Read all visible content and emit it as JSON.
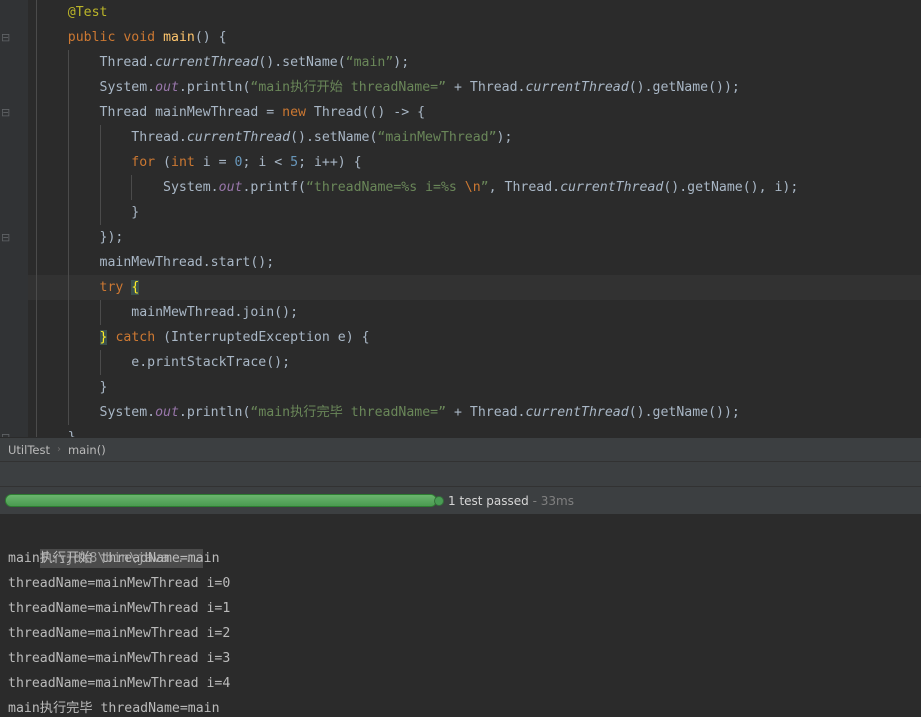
{
  "editor": {
    "lines": [
      {
        "indent": 0,
        "current": false,
        "fold": false,
        "tokens": [
          {
            "t": "anno",
            "v": "    @Test"
          }
        ]
      },
      {
        "indent": 0,
        "current": false,
        "fold": true,
        "tokens": [
          {
            "t": "plain",
            "v": "    "
          },
          {
            "t": "kw",
            "v": "public"
          },
          {
            "t": "plain",
            "v": " "
          },
          {
            "t": "kw",
            "v": "void"
          },
          {
            "t": "plain",
            "v": " "
          },
          {
            "t": "method",
            "v": "main"
          },
          {
            "t": "plain",
            "v": "() {"
          }
        ]
      },
      {
        "indent": 0,
        "current": false,
        "fold": false,
        "tokens": [
          {
            "t": "plain",
            "v": "        Thread."
          },
          {
            "t": "static",
            "v": "currentThread"
          },
          {
            "t": "plain",
            "v": "().setName("
          },
          {
            "t": "str",
            "v": "“main”"
          },
          {
            "t": "plain",
            "v": ");"
          }
        ]
      },
      {
        "indent": 0,
        "current": false,
        "fold": false,
        "tokens": [
          {
            "t": "plain",
            "v": "        System."
          },
          {
            "t": "field",
            "v": "out"
          },
          {
            "t": "plain",
            "v": ".println("
          },
          {
            "t": "str",
            "v": "“main执行开始 threadName=”"
          },
          {
            "t": "plain",
            "v": " + Thread."
          },
          {
            "t": "static",
            "v": "currentThread"
          },
          {
            "t": "plain",
            "v": "().getName());"
          }
        ]
      },
      {
        "indent": 0,
        "current": false,
        "fold": true,
        "tokens": [
          {
            "t": "plain",
            "v": "        Thread mainMewThread = "
          },
          {
            "t": "kw",
            "v": "new"
          },
          {
            "t": "plain",
            "v": " Thread(() -> {"
          }
        ]
      },
      {
        "indent": 0,
        "current": false,
        "fold": false,
        "tokens": [
          {
            "t": "plain",
            "v": "            Thread."
          },
          {
            "t": "static",
            "v": "currentThread"
          },
          {
            "t": "plain",
            "v": "().setName("
          },
          {
            "t": "str",
            "v": "“mainMewThread”"
          },
          {
            "t": "plain",
            "v": ");"
          }
        ]
      },
      {
        "indent": 0,
        "current": false,
        "fold": false,
        "tokens": [
          {
            "t": "plain",
            "v": "            "
          },
          {
            "t": "kw",
            "v": "for"
          },
          {
            "t": "plain",
            "v": " ("
          },
          {
            "t": "kw",
            "v": "int"
          },
          {
            "t": "plain",
            "v": " i = "
          },
          {
            "t": "num",
            "v": "0"
          },
          {
            "t": "plain",
            "v": "; i < "
          },
          {
            "t": "num",
            "v": "5"
          },
          {
            "t": "plain",
            "v": "; i++) {"
          }
        ]
      },
      {
        "indent": 0,
        "current": false,
        "fold": false,
        "tokens": [
          {
            "t": "plain",
            "v": "                System."
          },
          {
            "t": "field",
            "v": "out"
          },
          {
            "t": "plain",
            "v": ".printf("
          },
          {
            "t": "str",
            "v": "“threadName=%s i=%s "
          },
          {
            "t": "esc",
            "v": "\\n"
          },
          {
            "t": "str",
            "v": "”"
          },
          {
            "t": "plain",
            "v": ", Thread."
          },
          {
            "t": "static",
            "v": "currentThread"
          },
          {
            "t": "plain",
            "v": "().getName(), i);"
          }
        ]
      },
      {
        "indent": 0,
        "current": false,
        "fold": false,
        "tokens": [
          {
            "t": "plain",
            "v": "            }"
          }
        ]
      },
      {
        "indent": 0,
        "current": false,
        "fold": true,
        "tokens": [
          {
            "t": "plain",
            "v": "        });"
          }
        ]
      },
      {
        "indent": 0,
        "current": false,
        "fold": false,
        "tokens": [
          {
            "t": "plain",
            "v": "        mainMewThread.start();"
          }
        ]
      },
      {
        "indent": 0,
        "current": true,
        "fold": false,
        "tokens": [
          {
            "t": "plain",
            "v": "        "
          },
          {
            "t": "kw",
            "v": "try"
          },
          {
            "t": "plain",
            "v": " "
          },
          {
            "t": "brace",
            "v": "{"
          }
        ]
      },
      {
        "indent": 0,
        "current": false,
        "fold": false,
        "tokens": [
          {
            "t": "plain",
            "v": "            mainMewThread.join();"
          }
        ]
      },
      {
        "indent": 0,
        "current": false,
        "fold": false,
        "tokens": [
          {
            "t": "plain",
            "v": "        "
          },
          {
            "t": "brace",
            "v": "}"
          },
          {
            "t": "plain",
            "v": " "
          },
          {
            "t": "kw",
            "v": "catch"
          },
          {
            "t": "plain",
            "v": " (InterruptedException e) {"
          }
        ]
      },
      {
        "indent": 0,
        "current": false,
        "fold": false,
        "tokens": [
          {
            "t": "plain",
            "v": "            e.printStackTrace();"
          }
        ]
      },
      {
        "indent": 0,
        "current": false,
        "fold": false,
        "tokens": [
          {
            "t": "plain",
            "v": "        }"
          }
        ]
      },
      {
        "indent": 0,
        "current": false,
        "fold": false,
        "tokens": [
          {
            "t": "plain",
            "v": "        System."
          },
          {
            "t": "field",
            "v": "out"
          },
          {
            "t": "plain",
            "v": ".println("
          },
          {
            "t": "str",
            "v": "“main执行完毕 threadName=”"
          },
          {
            "t": "plain",
            "v": " + Thread."
          },
          {
            "t": "static",
            "v": "currentThread"
          },
          {
            "t": "plain",
            "v": "().getName());"
          }
        ]
      },
      {
        "indent": 0,
        "current": false,
        "fold": true,
        "tokens": [
          {
            "t": "plain",
            "v": "    }"
          }
        ]
      }
    ]
  },
  "breadcrumb": {
    "class_name": "UtilTest",
    "separator": "›",
    "method_name": "main()"
  },
  "test_status": {
    "icon": "green-circle-passed-icon",
    "message": "1 test passed",
    "duration": "- 33ms",
    "progress_percent": 100,
    "accent_color": "#4caf50"
  },
  "console": {
    "command": "F:\\jdk8\\bin\\java ...",
    "output": [
      "main执行开始 threadName=main",
      "threadName=mainMewThread i=0",
      "threadName=mainMewThread i=1",
      "threadName=mainMewThread i=2",
      "threadName=mainMewThread i=3",
      "threadName=mainMewThread i=4",
      "main执行完毕 threadName=main"
    ]
  }
}
